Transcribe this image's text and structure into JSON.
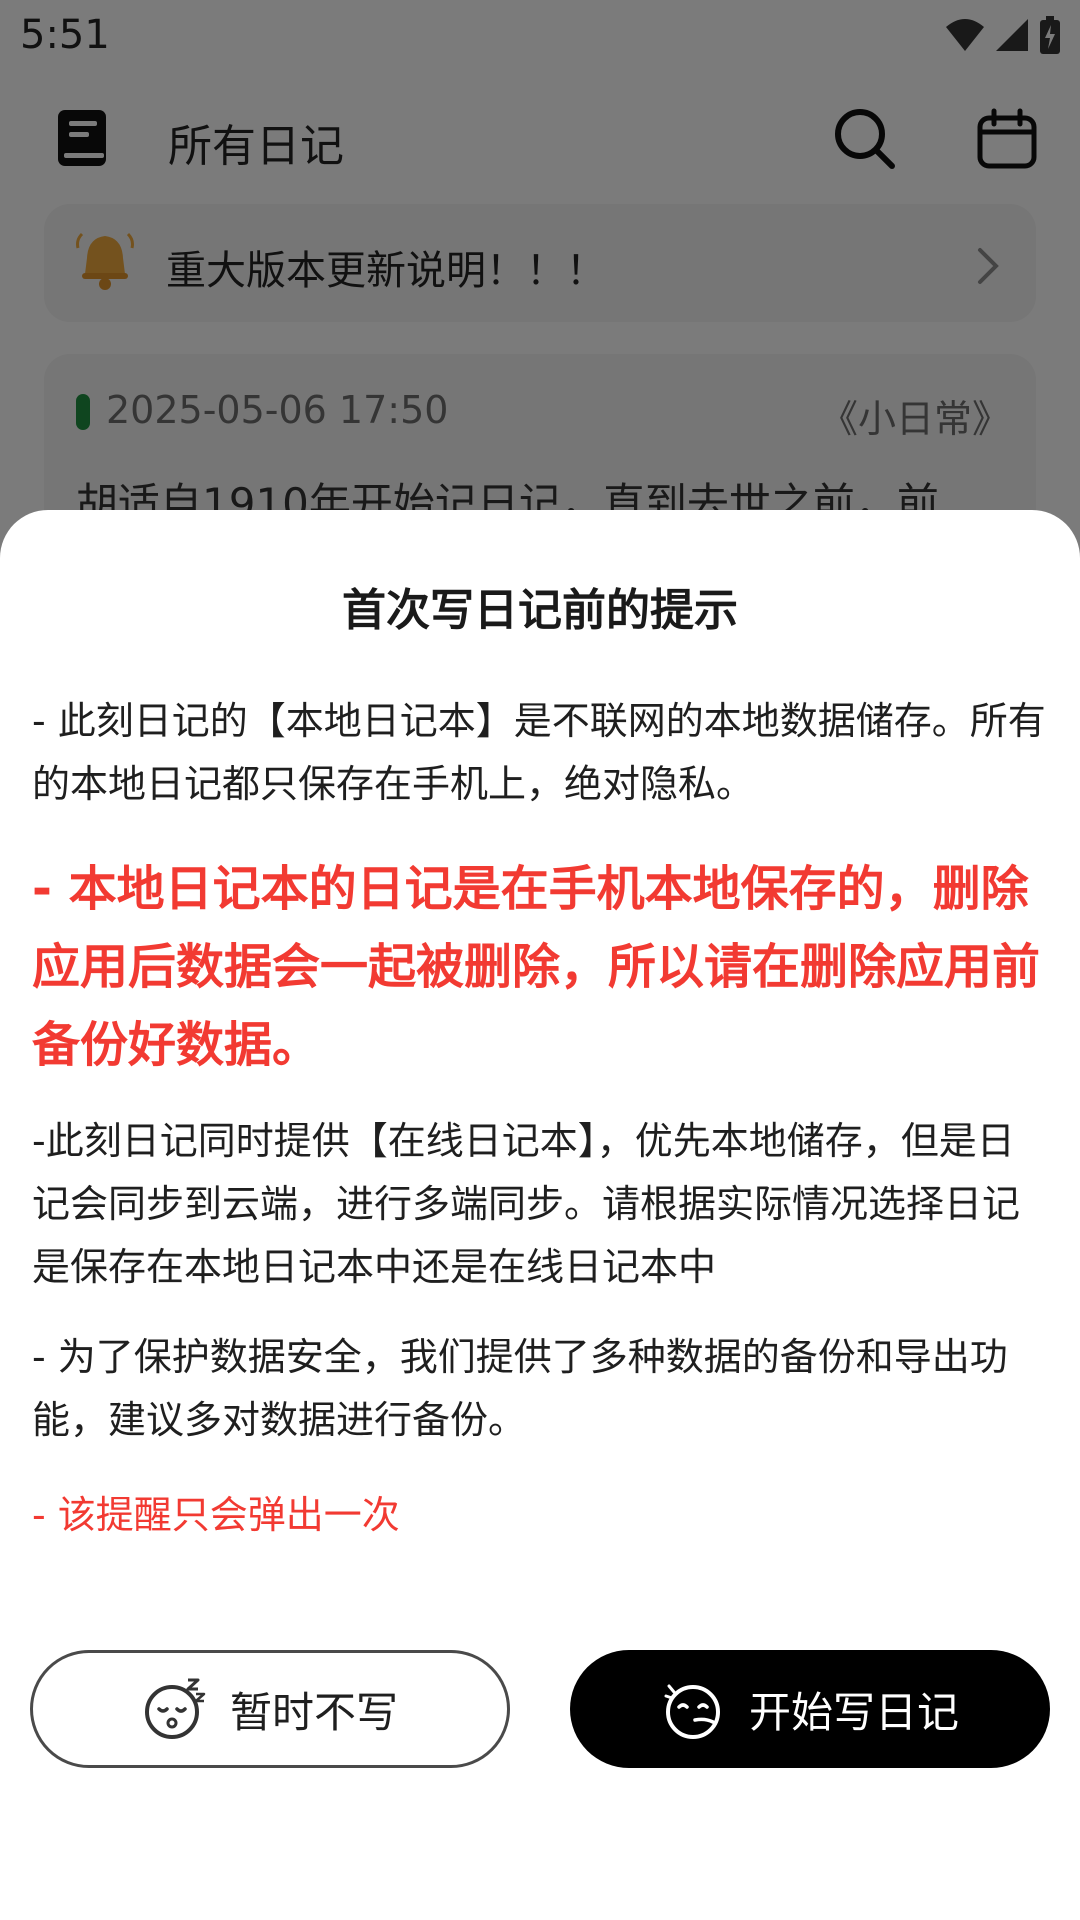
{
  "status_bar": {
    "time": "5:51"
  },
  "app_bar": {
    "title": "所有日记",
    "left_icon": "book-icon",
    "right_icons": [
      "search-icon",
      "calendar-icon"
    ]
  },
  "notice": {
    "text": "重大版本更新说明！！！",
    "icon": "bell-icon"
  },
  "diary_entry": {
    "datetime": "2025-05-06 17:50",
    "notebook": "《小日常》",
    "excerpt": "胡适自1910年开始记日记，直到去世之前，前"
  },
  "dialog": {
    "title": "首次写日记前的提示",
    "paragraph_1": "- 此刻日记的【本地日记本】是不联网的本地数据储存。所有的本地日记都只保存在手机上，绝对隐私。",
    "warning": "- 本地日记本的日记是在手机本地保存的，删除应用后数据会一起被删除，所以请在删除应用前备份好数据。",
    "paragraph_2": "-此刻日记同时提供【在线日记本】，优先本地储存，但是日记会同步到云端，进行多端同步。请根据实际情况选择日记是保存在本地日记本中还是在线日记本中",
    "paragraph_3": "- 为了保护数据安全，我们提供了多种数据的备份和导出功能，建议多对数据进行备份。",
    "note": "- 该提醒只会弹出一次",
    "cancel_label": "暂时不写",
    "confirm_label": "开始写日记"
  },
  "colors": {
    "warning_red": "#f23a32",
    "primary_button": "#000000",
    "entry_marker": "#1f8a3e"
  }
}
